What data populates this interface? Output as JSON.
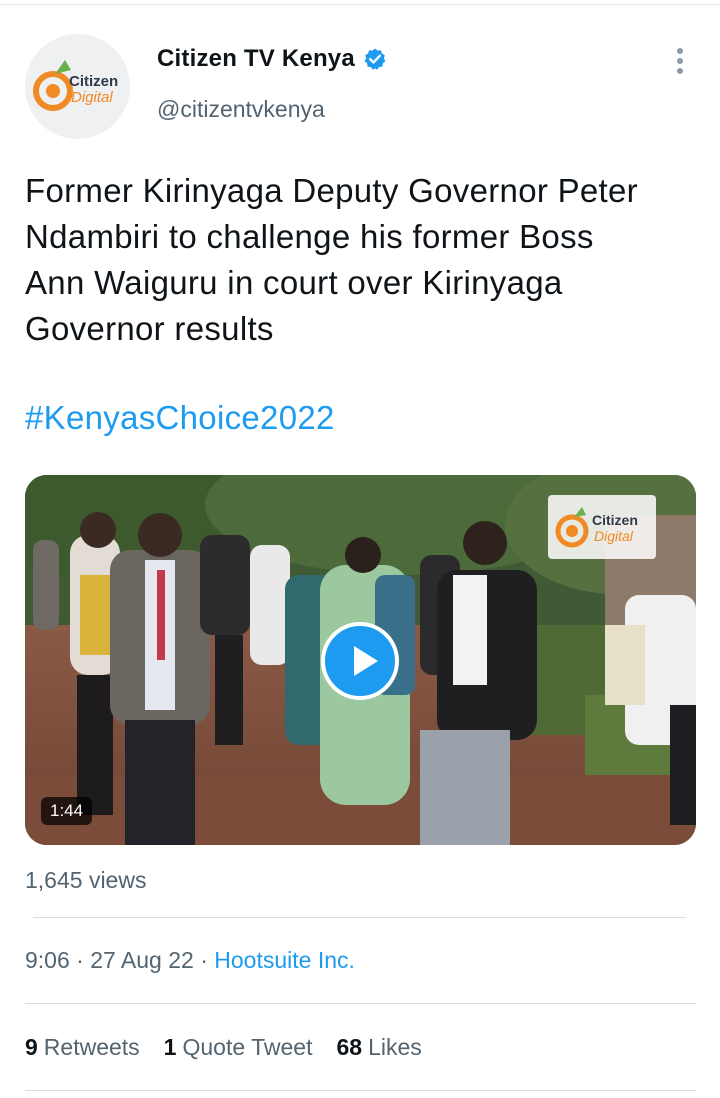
{
  "author": {
    "display_name": "Citizen TV Kenya",
    "handle": "@citizentvkenya",
    "avatar_brand": [
      "Citizen",
      "Digital"
    ],
    "verified": true,
    "icons": {
      "verified": "verified-badge-icon",
      "more": "more-options-icon"
    }
  },
  "tweet": {
    "text_lines": [
      "Former Kirinyaga Deputy Governor Peter",
      "Ndambiri to challenge his former Boss",
      "Ann Waiguru in court over Kirinyaga",
      "Governor results"
    ],
    "hashtag": "#KenyasChoice2022"
  },
  "media": {
    "watermark": [
      "Citizen",
      "Digital"
    ],
    "duration": "1:44",
    "play_icon": "play-icon"
  },
  "views": "1,645 views",
  "meta": {
    "time": "9:06",
    "date": "27 Aug 22",
    "separator": "·",
    "source": "Hootsuite Inc."
  },
  "stats": {
    "retweets_count": "9",
    "retweets_label": "Retweets",
    "quotes_count": "1",
    "quotes_label": "Quote Tweet",
    "likes_count": "68",
    "likes_label": "Likes"
  },
  "colors": {
    "accent": "#1d9bf0",
    "text": "#0f1419",
    "secondary": "#536471",
    "brand_orange": "#f08a24"
  }
}
